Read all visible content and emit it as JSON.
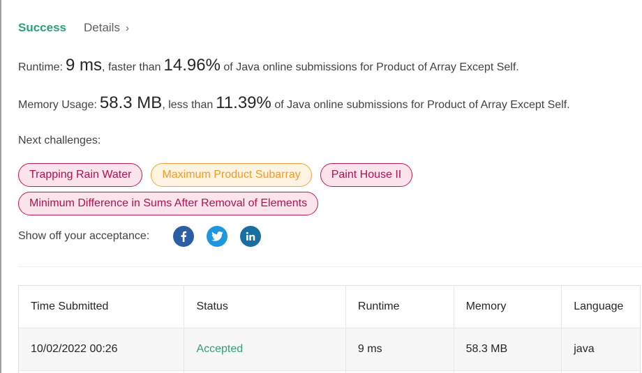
{
  "header": {
    "success_label": "Success",
    "details_label": "Details",
    "details_chevron": "›"
  },
  "runtime": {
    "label": "Runtime:",
    "value": "9 ms",
    "comparison": ", faster than",
    "percent": "14.96%",
    "suffix": "of Java online submissions for Product of Array Except Self."
  },
  "memory": {
    "label": "Memory Usage:",
    "value": "58.3 MB",
    "comparison": ", less than",
    "percent": "11.39%",
    "suffix": "of Java online submissions for Product of Array Except Self."
  },
  "next_challenges": {
    "label": "Next challenges:",
    "items": [
      {
        "label": "Trapping Rain Water",
        "difficulty": "hard"
      },
      {
        "label": "Maximum Product Subarray",
        "difficulty": "medium"
      },
      {
        "label": "Paint House II",
        "difficulty": "hard"
      },
      {
        "label": "Minimum Difference in Sums After Removal of Elements",
        "difficulty": "hard"
      }
    ]
  },
  "share": {
    "label": "Show off your acceptance:",
    "icons": [
      "facebook-icon",
      "twitter-icon",
      "linkedin-icon"
    ]
  },
  "table": {
    "headers": [
      "Time Submitted",
      "Status",
      "Runtime",
      "Memory",
      "Language"
    ],
    "rows": [
      [
        "10/02/2022 00:26",
        "Accepted",
        "9 ms",
        "58.3 MB",
        "java"
      ]
    ]
  },
  "colors": {
    "success": "#2f9e7a",
    "hard": "#c2185b",
    "medium": "#f0a43c",
    "facebook": "#2c5ea5",
    "twitter": "#1e97df",
    "linkedin": "#1b6ea0"
  }
}
